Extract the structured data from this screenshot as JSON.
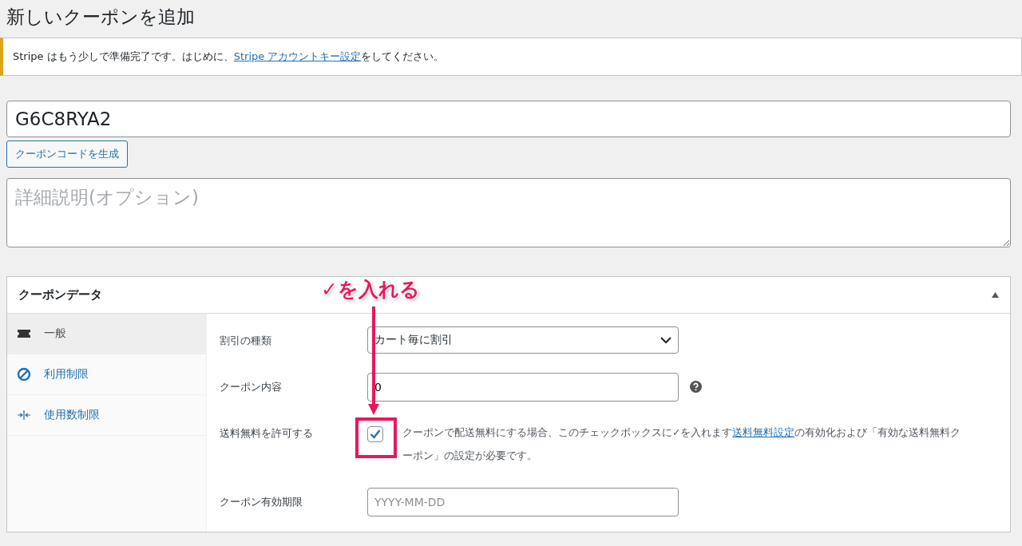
{
  "page_title": "新しいクーポンを追加",
  "notice": {
    "text_before": "Stripe はもう少しで準備完了です。はじめに、",
    "link": "Stripe アカウントキー設定",
    "text_after": "をしてください。"
  },
  "coupon_code": {
    "value": "G6C8RYA2"
  },
  "generate_button": "クーポンコードを生成",
  "description": {
    "placeholder": "詳細説明(オプション)"
  },
  "panel": {
    "title": "クーポンデータ",
    "expanded": true,
    "tabs": [
      {
        "label": "一般",
        "selected": true
      },
      {
        "label": "利用制限",
        "selected": false
      },
      {
        "label": "使用数制限",
        "selected": false
      }
    ],
    "fields": [
      {
        "kind": "select",
        "label": "割引の種類",
        "value": "カート毎に割引"
      },
      {
        "kind": "input",
        "label": "クーポン内容",
        "value": "0",
        "help": true
      },
      {
        "kind": "checkbox",
        "label": "送料無料を許可する",
        "checked": true,
        "text_before": "クーポンで配送無料にする場合、このチェックボックスに✓を入れます",
        "link": "送料無料設定",
        "text_after": "の有効化および「有効な送料無料クーポン」の設定が必要です。"
      },
      {
        "kind": "input",
        "label": "クーポン有効期限",
        "placeholder": "YYYY-MM-DD"
      }
    ]
  },
  "annotation": {
    "text": "✓を入れる"
  }
}
